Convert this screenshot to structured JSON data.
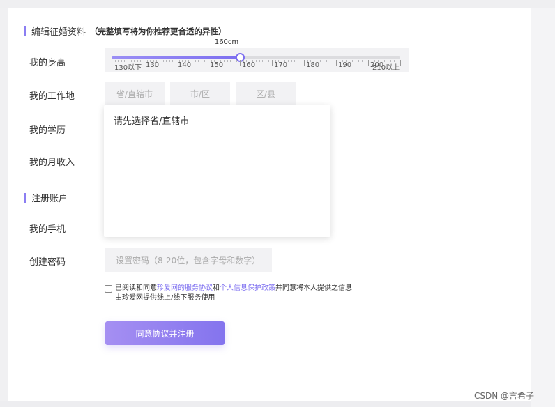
{
  "section1": {
    "title": "编辑征婚资料",
    "note": "（完整填写将为你推荐更合适的异性）"
  },
  "labels": {
    "height": "我的身高",
    "work": "我的工作地",
    "education": "我的学历",
    "income": "我的月收入",
    "phone": "我的手机",
    "password": "创建密码"
  },
  "slider": {
    "value_label": "160cm",
    "min": 130,
    "max": 210,
    "value": 160,
    "tick_labels": [
      "130以下",
      "130",
      "140",
      "150",
      "160",
      "170",
      "180",
      "190",
      "200",
      "210以上"
    ]
  },
  "work": {
    "province": "省/直辖市",
    "city": "市/区",
    "district": "区/县"
  },
  "dropdown": {
    "text": "请先选择省/直辖市"
  },
  "section2": {
    "title": "注册账户"
  },
  "password": {
    "placeholder": "设置密码（8-20位，包含字母和数字）"
  },
  "agreement": {
    "prefix": "已阅读和同意",
    "link1": "珍爱网的服务协议",
    "and": "和",
    "link2": "个人信息保护政策",
    "suffix": "并同意将本人提供之信息",
    "line2": "由珍爱网提供线上/线下服务使用"
  },
  "submit": {
    "label": "同意协议并注册"
  },
  "watermark": "CSDN @言希子",
  "colors": {
    "accent": "#7d6ff0",
    "field_bg": "#f2f2f4"
  }
}
